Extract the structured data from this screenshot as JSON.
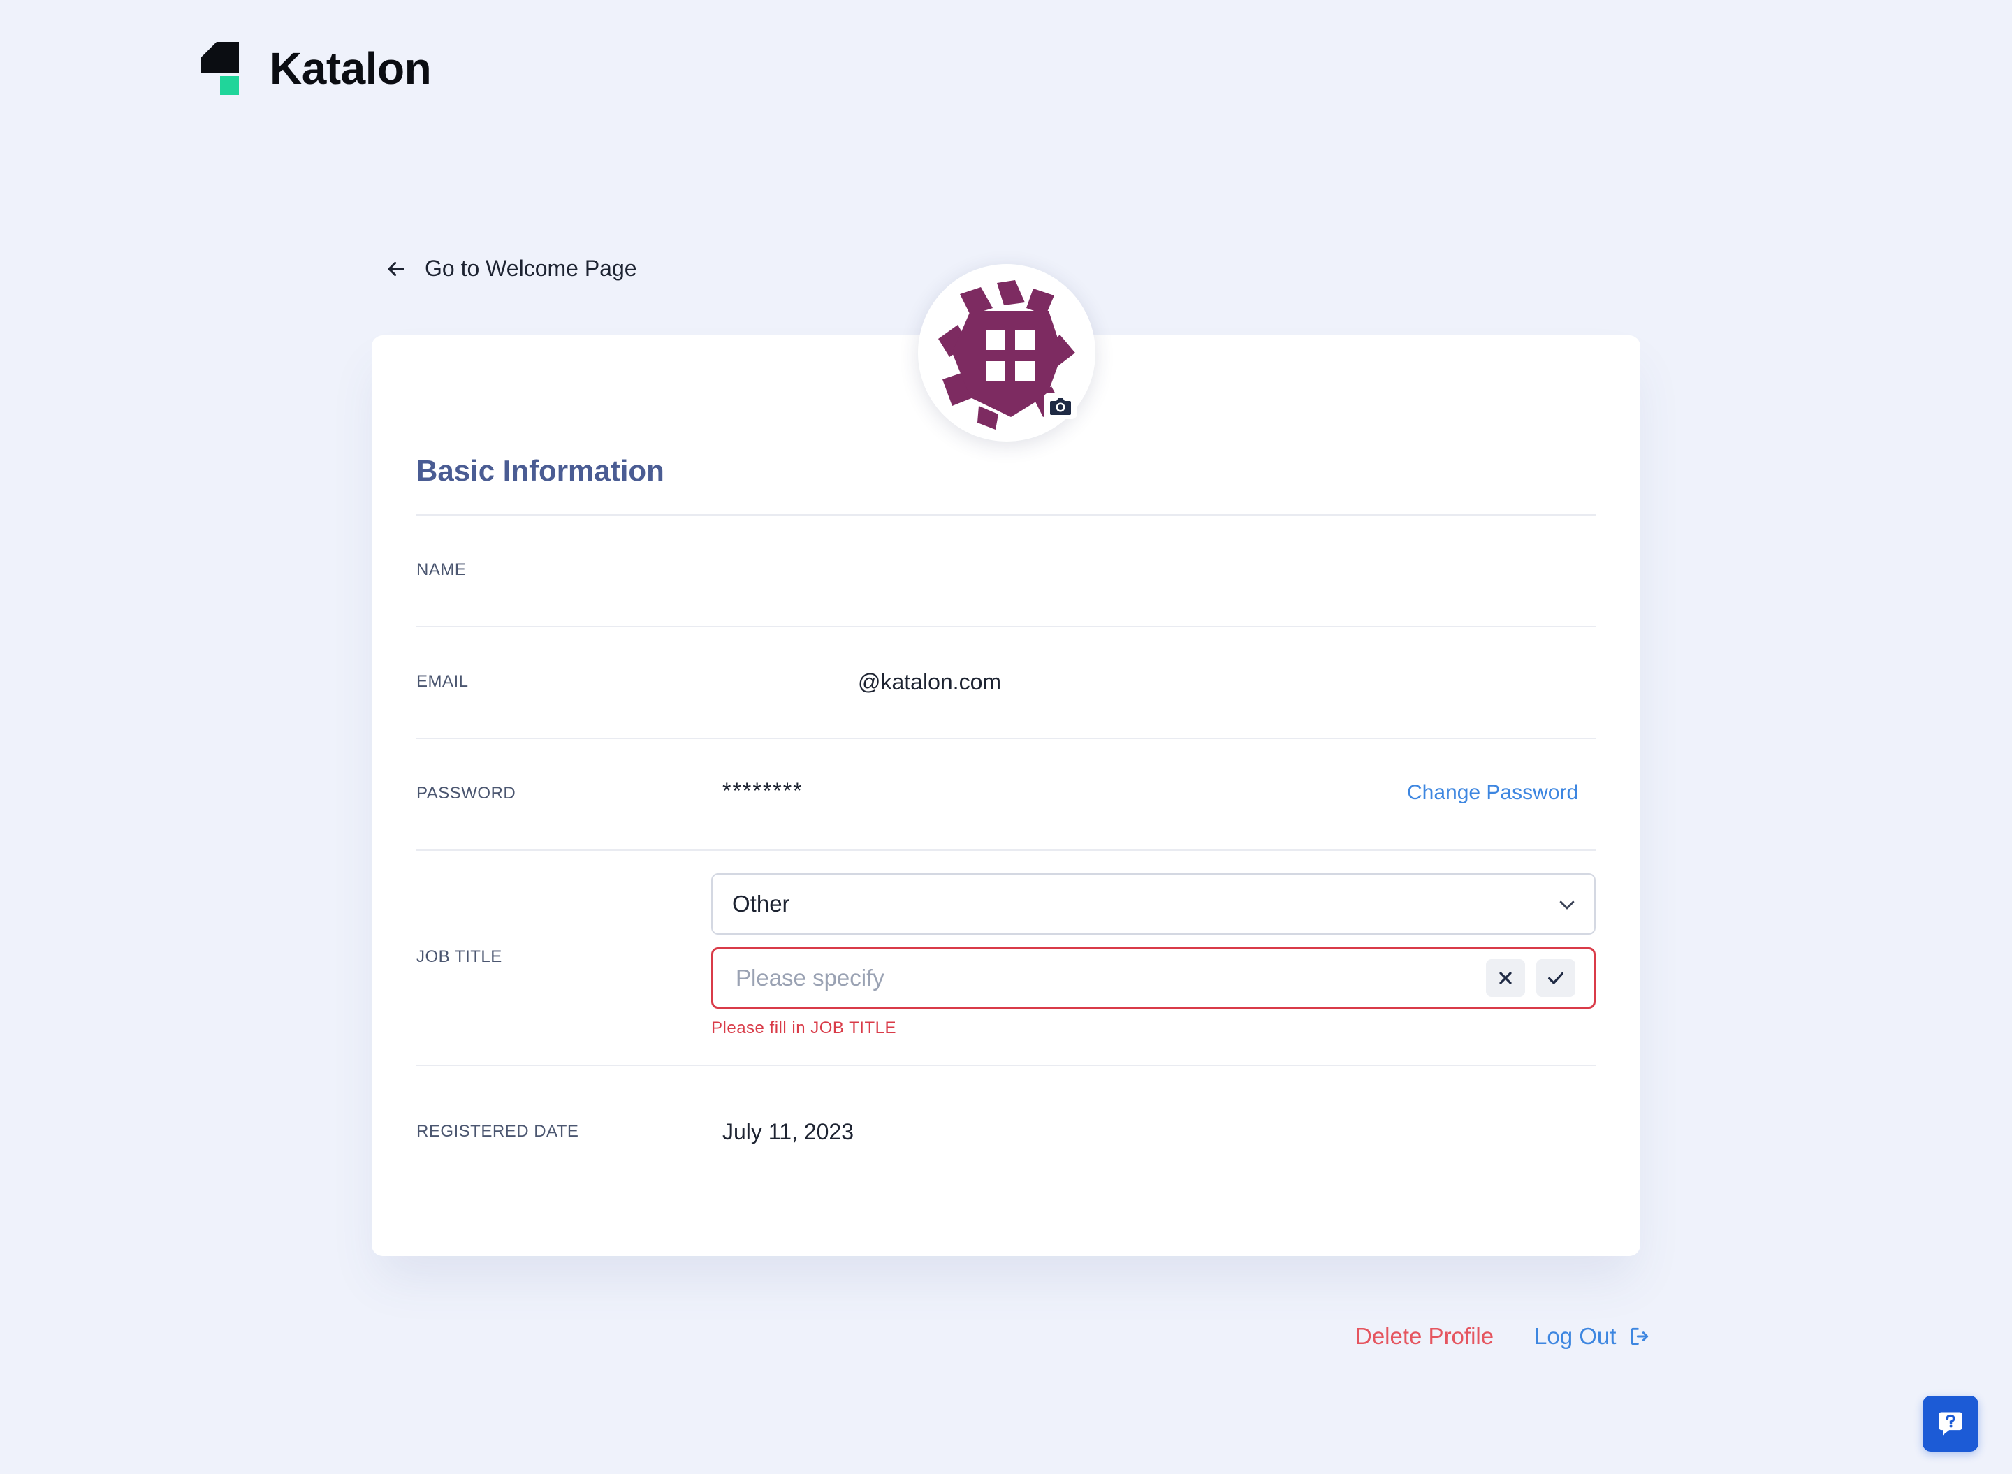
{
  "brand": {
    "name": "Katalon",
    "logo_icon": "katalon-logo-icon"
  },
  "nav": {
    "back_label": "Go to Welcome Page",
    "back_icon": "arrow-left-icon"
  },
  "avatar": {
    "icon": "identicon-avatar",
    "camera_icon": "camera-icon"
  },
  "section": {
    "title": "Basic Information"
  },
  "fields": {
    "name": {
      "label": "NAME",
      "value": ""
    },
    "email": {
      "label": "EMAIL",
      "value": "@katalon.com"
    },
    "password": {
      "label": "PASSWORD",
      "value": "********",
      "action": "Change Password"
    },
    "job_title": {
      "label": "JOB TITLE",
      "selected": "Other",
      "specify_placeholder": "Please specify",
      "specify_value": "",
      "error": "Please fill in JOB TITLE"
    },
    "registered_date": {
      "label": "REGISTERED DATE",
      "value": "July 11, 2023"
    }
  },
  "footer": {
    "delete_label": "Delete Profile",
    "logout_label": "Log Out",
    "logout_icon": "logout-icon"
  },
  "help": {
    "icon": "help-chat-icon"
  },
  "colors": {
    "background": "#eff2fb",
    "section_title": "#4a5c93",
    "link_blue": "#3d86e0",
    "danger_red": "#d93b48",
    "delete_red": "#e5555f",
    "help_button": "#1c5bd6",
    "avatar_purple": "#7d2b61",
    "logo_green": "#20d59a"
  }
}
